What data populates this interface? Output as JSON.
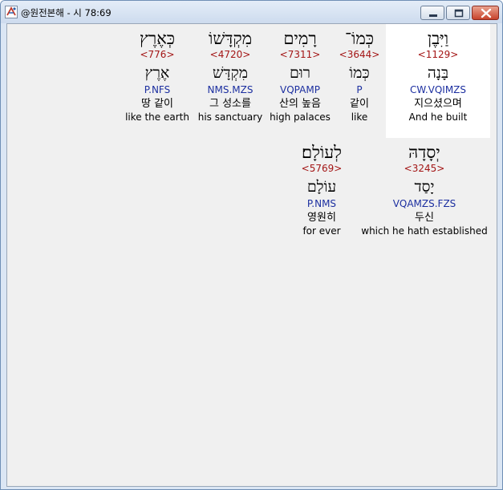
{
  "window": {
    "title": "@원전본해 - 시 78:69"
  },
  "colors": {
    "strong": "#a31515",
    "morph": "#1c2fa0",
    "selected_bg": "#ffffff",
    "client_bg": "#f0f0f0"
  },
  "lines": [
    {
      "words": [
        {
          "hebrew": "וַיִּבֶן",
          "strong": "<1129>",
          "lemma": "בָּנָה",
          "morph": "CW.VQIMZS",
          "korean": "지으셨으며",
          "english": "And he built",
          "selected": true
        },
        {
          "hebrew": "כְּמוֹ־",
          "strong": "<3644>",
          "lemma": "כְּמוֹ",
          "morph": "P",
          "korean": "같이",
          "english": "like"
        },
        {
          "hebrew": "רָמִים",
          "strong": "<7311>",
          "lemma": "רוּם",
          "morph": "VQPAMP",
          "korean": "산의 높음",
          "english": "high palaces"
        },
        {
          "hebrew": "מִקְדָּשׁוֹ",
          "strong": "<4720>",
          "lemma": "מִקְדָּשׁ",
          "morph": "NMS.MZS",
          "korean": "그 성소를",
          "english": "his sanctuary"
        },
        {
          "hebrew": "כְּאֶרֶץ",
          "strong": "<776>",
          "lemma": "אֶרֶץ",
          "morph": "P.NFS",
          "korean": "땅 같이",
          "english": "like the earth"
        }
      ]
    },
    {
      "words": [
        {
          "hebrew": "יְסָדָהּ",
          "strong": "<3245>",
          "lemma": "יָסַד",
          "morph": "VQAMZS.FZS",
          "korean": "두신",
          "english": "which he hath established"
        },
        {
          "hebrew": "לְעוֹלָם׃",
          "strong": "<5769>",
          "lemma": "עוֹלָם",
          "morph": "P.NMS",
          "korean": "영원히",
          "english": "for ever"
        }
      ]
    }
  ]
}
